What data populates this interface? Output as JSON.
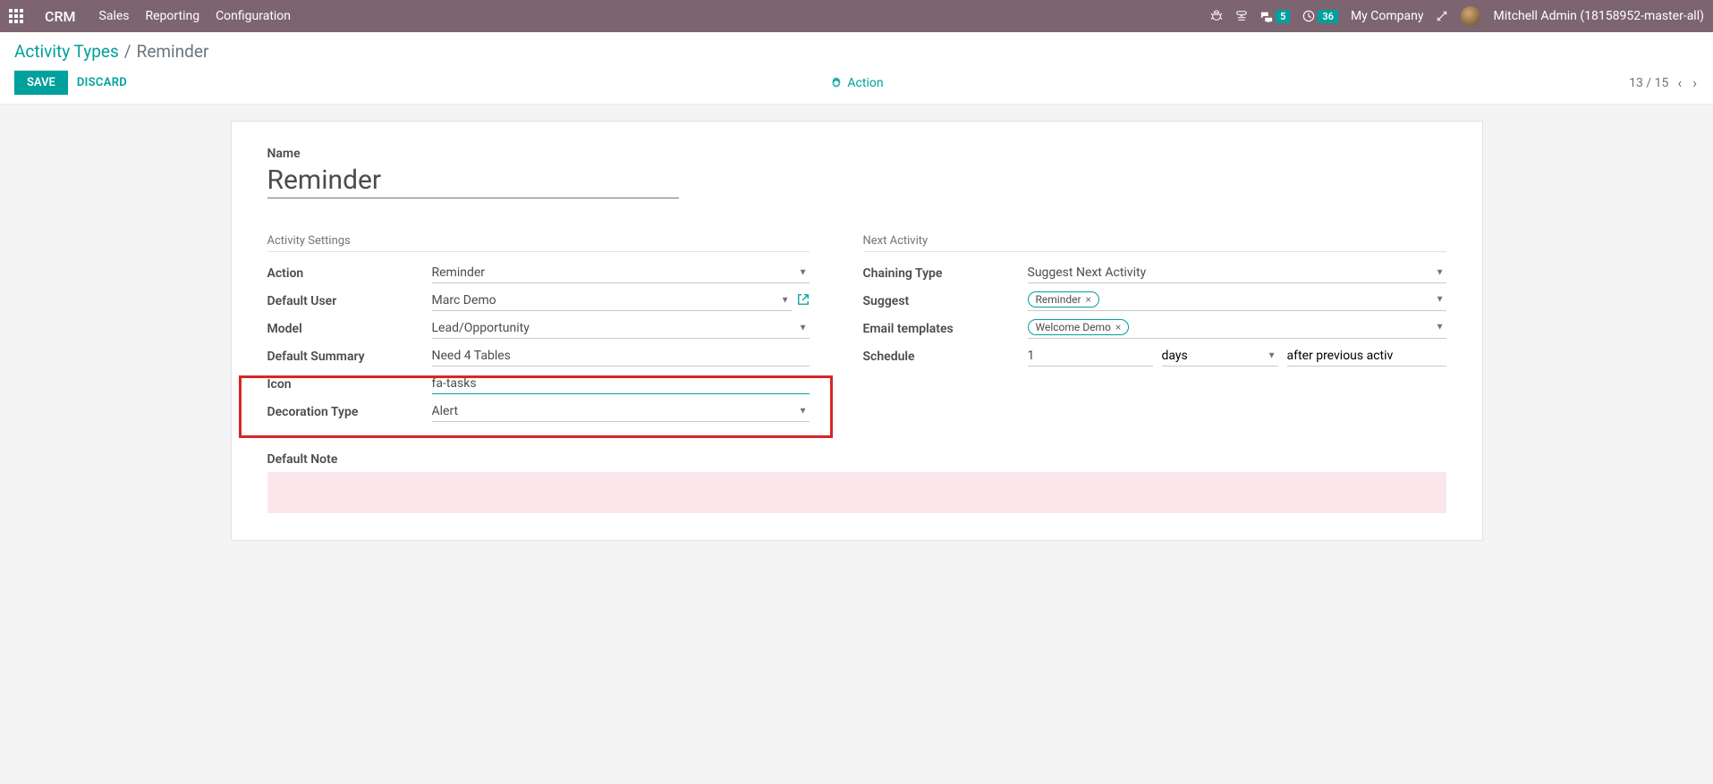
{
  "navbar": {
    "brand": "CRM",
    "menu": [
      "Sales",
      "Reporting",
      "Configuration"
    ],
    "msg_badge": "5",
    "clock_badge": "36",
    "company": "My Company",
    "user": "Mitchell Admin (18158952-master-all)"
  },
  "breadcrumb": {
    "parent": "Activity Types",
    "current": "Reminder"
  },
  "buttons": {
    "save": "SAVE",
    "discard": "DISCARD",
    "action": "Action"
  },
  "pager": {
    "text": "13 / 15"
  },
  "form": {
    "name_label": "Name",
    "name_value": "Reminder",
    "sections": {
      "activity": "Activity Settings",
      "next": "Next Activity"
    },
    "activity": {
      "action_label": "Action",
      "action_value": "Reminder",
      "default_user_label": "Default User",
      "default_user_value": "Marc Demo",
      "model_label": "Model",
      "model_value": "Lead/Opportunity",
      "default_summary_label": "Default Summary",
      "default_summary_value": "Need 4 Tables",
      "icon_label": "Icon",
      "icon_value": "fa-tasks",
      "decoration_label": "Decoration Type",
      "decoration_value": "Alert"
    },
    "next": {
      "chaining_label": "Chaining Type",
      "chaining_value": "Suggest Next Activity",
      "suggest_label": "Suggest",
      "suggest_tag": "Reminder",
      "email_label": "Email templates",
      "email_tag": "Welcome Demo",
      "schedule_label": "Schedule",
      "schedule_count": "1",
      "schedule_unit": "days",
      "schedule_after": "after previous activ"
    },
    "default_note_label": "Default Note"
  }
}
